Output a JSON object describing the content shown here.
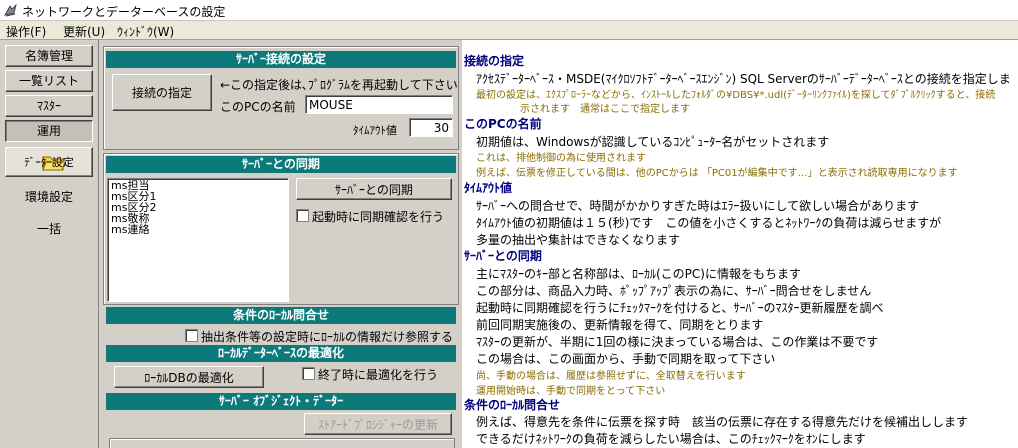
{
  "window": {
    "title": "ネットワークとデーターベースの設定"
  },
  "menu": [
    "操作(F)",
    "更新(U)",
    "ｳｨﾝﾄﾞｳ(W)"
  ],
  "sidebar": {
    "items": [
      "名簿管理",
      "一覧リスト",
      "ﾏｽﾀｰ",
      "運用",
      "ﾃﾞｰﾀｰ設定",
      "環境設定",
      "一括"
    ],
    "selected": "ﾃﾞｰﾀｰ設定"
  },
  "server_connect": {
    "header": "ｻｰﾊﾞｰ接続の設定",
    "connect_button": "接続の指定",
    "note": "←この指定後は､ﾌﾟﾛｸﾞﾗﾑを再起動して下さい",
    "pc_name_label": "このPCの名前",
    "pc_name_value": "MOUSE",
    "timeout_label": "ﾀｲﾑｱｳﾄ値",
    "timeout_value": "30"
  },
  "server_sync": {
    "header": "ｻｰﾊﾞｰとの同期",
    "list_items": [
      "ms担当",
      "ms区分1",
      "ms区分2",
      "ms敬称",
      "ms連絡"
    ],
    "sync_button": "ｻｰﾊﾞｰとの同期",
    "startup_check_label": "起動時に同期確認を行う"
  },
  "local_query": {
    "header": "条件のﾛｰｶﾙ問合せ",
    "check_label": "抽出条件等の設定時にﾛｰｶﾙの情報だけ参照する"
  },
  "local_db": {
    "header": "ﾛｰｶﾙﾃﾞｰﾀｰﾍﾞｰｽの最適化",
    "optimize_button": "ﾛｰｶﾙDBの最適化",
    "exit_check_label": "終了時に最適化を行う"
  },
  "server_objects": {
    "header": "ｻｰﾊﾞｰ ｵﾌﾞｼﾞｪｸﾄ・ﾃﾞｰﾀｰ",
    "update_button": "ｽﾄｱｰﾄﾞﾌﾟﾛｼｼﾞｬｰの更新"
  },
  "help": {
    "sec1_title": "接続の指定",
    "sec1_line1": "ｱｸｾｽﾃﾞｰﾀｰﾍﾞｰｽ・MSDE(ﾏｲｸﾛｿﾌﾄﾃﾞｰﾀｰﾍﾞｰｽｴﾝｼﾞﾝ) SQL Serverのｻｰﾊﾞｰﾃﾞｰﾀｰﾍﾞｰｽとの接続を指定しま",
    "sec1_note1": "最初の設定は、ｴｸｽﾌﾟﾛｰﾗｰなどから、ｲﾝｽﾄｰﾙしたﾌｫﾙﾀﾞの¥DBS¥*.udl(ﾃﾞｰﾀｰﾘﾝｸﾌｧｲﾙ)を探してﾀﾞﾌﾞﾙｸﾘｯｸすると、接続",
    "sec1_note2": "示されます　通常はここで指定します",
    "sec2_title": "このPCの名前",
    "sec2_line1": "初期値は、Windowsが認識しているｺﾝﾋﾟｭｰﾀｰ名がセットされます",
    "sec2_note1": "これは、排他制御の為に使用されます",
    "sec2_note2": "例えば、伝票を修正している間は、他のPCからは 「PC01が編集中です…」と表示され読取専用になります",
    "sec3_title": "ﾀｲﾑｱｳﾄ値",
    "sec3_line1": "ｻｰﾊﾞｰへの問合せで、時間がかかりすぎた時はｴﾗｰ扱いにして欲しい場合があります",
    "sec3_line2": "ﾀｲﾑｱｳﾄ値の初期値は１５(秒)です　この値を小さくするとﾈｯﾄﾜｰｸの負荷は減らせますが",
    "sec3_line3": "多量の抽出や集計はできなくなります",
    "sec4_title": "ｻｰﾊﾞｰとの同期",
    "sec4_line1": "主にﾏｽﾀｰのｷｰ部と名称部は、ﾛｰｶﾙ(このPC)に情報をもちます",
    "sec4_line2": "この部分は、商品入力時、ﾎﾟｯﾌﾟｱｯﾌﾟ表示の為に、ｻｰﾊﾞｰ問合せをしません",
    "sec4_line3": "起動時に同期確認を行うにﾁｪｯｸﾏｰｸを付けると、ｻｰﾊﾞｰのﾏｽﾀｰ更新履歴を調べ",
    "sec4_line4": "前回同期実施後の、更新情報を得て、同期をとります",
    "sec4_line5": "ﾏｽﾀｰの更新が、半期に1回の様に決まっている場合は、この作業は不要です",
    "sec4_line6": "この場合は、この画面から、手動で同期を取って下さい",
    "sec4_note1": "尚、手動の場合は、履歴は参照せずに、全取替えを行います",
    "sec4_note2": "運用開始時は、手動で同期をとって下さい",
    "sec5_title": "条件のﾛｰｶﾙ問合せ",
    "sec5_line1": "例えば、得意先を条件に伝票を探す時　該当の伝票に存在する得意先だけを候補出しします",
    "sec5_line2": "できるだけﾈｯﾄﾜｰｸの負荷を減らしたい場合は、このﾁｪｯｸﾏｰｸをｵﾝにします"
  }
}
